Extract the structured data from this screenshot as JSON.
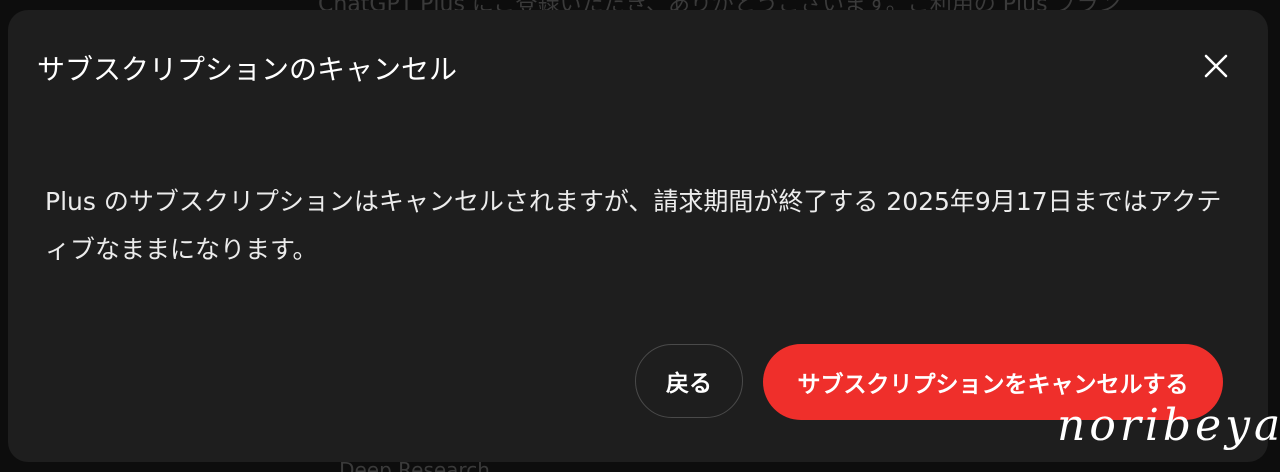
{
  "background": {
    "top_text": "ChatGPT Plus にご登録いただき、ありがとうございます。ご利用の Plus プラン",
    "bottom_text": "...Deep Research ...",
    "color": "#0d0d0d"
  },
  "dialog": {
    "title": "サブスクリプションのキャンセル",
    "close_icon": "close-icon",
    "body": "Plus のサブスクリプションはキャンセルされますが、請求期間が終了する 2025年9月17日まではアクティブなままになります。",
    "back_label": "戻る",
    "confirm_label": "サブスクリプションをキャンセルする",
    "colors": {
      "surface": "#1e1e1e",
      "danger": "#ef2f2b"
    }
  },
  "watermark": "noribeya"
}
